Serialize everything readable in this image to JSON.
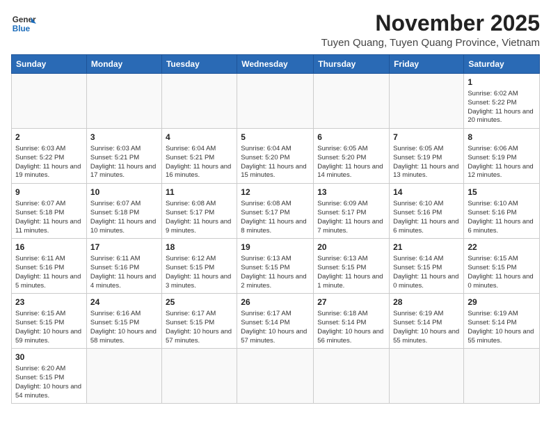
{
  "header": {
    "logo_general": "General",
    "logo_blue": "Blue",
    "month_title": "November 2025",
    "location": "Tuyen Quang, Tuyen Quang Province, Vietnam"
  },
  "days_of_week": [
    "Sunday",
    "Monday",
    "Tuesday",
    "Wednesday",
    "Thursday",
    "Friday",
    "Saturday"
  ],
  "weeks": [
    [
      {
        "day": "",
        "info": ""
      },
      {
        "day": "",
        "info": ""
      },
      {
        "day": "",
        "info": ""
      },
      {
        "day": "",
        "info": ""
      },
      {
        "day": "",
        "info": ""
      },
      {
        "day": "",
        "info": ""
      },
      {
        "day": "1",
        "info": "Sunrise: 6:02 AM\nSunset: 5:22 PM\nDaylight: 11 hours and 20 minutes."
      }
    ],
    [
      {
        "day": "2",
        "info": "Sunrise: 6:03 AM\nSunset: 5:22 PM\nDaylight: 11 hours and 19 minutes."
      },
      {
        "day": "3",
        "info": "Sunrise: 6:03 AM\nSunset: 5:21 PM\nDaylight: 11 hours and 17 minutes."
      },
      {
        "day": "4",
        "info": "Sunrise: 6:04 AM\nSunset: 5:21 PM\nDaylight: 11 hours and 16 minutes."
      },
      {
        "day": "5",
        "info": "Sunrise: 6:04 AM\nSunset: 5:20 PM\nDaylight: 11 hours and 15 minutes."
      },
      {
        "day": "6",
        "info": "Sunrise: 6:05 AM\nSunset: 5:20 PM\nDaylight: 11 hours and 14 minutes."
      },
      {
        "day": "7",
        "info": "Sunrise: 6:05 AM\nSunset: 5:19 PM\nDaylight: 11 hours and 13 minutes."
      },
      {
        "day": "8",
        "info": "Sunrise: 6:06 AM\nSunset: 5:19 PM\nDaylight: 11 hours and 12 minutes."
      }
    ],
    [
      {
        "day": "9",
        "info": "Sunrise: 6:07 AM\nSunset: 5:18 PM\nDaylight: 11 hours and 11 minutes."
      },
      {
        "day": "10",
        "info": "Sunrise: 6:07 AM\nSunset: 5:18 PM\nDaylight: 11 hours and 10 minutes."
      },
      {
        "day": "11",
        "info": "Sunrise: 6:08 AM\nSunset: 5:17 PM\nDaylight: 11 hours and 9 minutes."
      },
      {
        "day": "12",
        "info": "Sunrise: 6:08 AM\nSunset: 5:17 PM\nDaylight: 11 hours and 8 minutes."
      },
      {
        "day": "13",
        "info": "Sunrise: 6:09 AM\nSunset: 5:17 PM\nDaylight: 11 hours and 7 minutes."
      },
      {
        "day": "14",
        "info": "Sunrise: 6:10 AM\nSunset: 5:16 PM\nDaylight: 11 hours and 6 minutes."
      },
      {
        "day": "15",
        "info": "Sunrise: 6:10 AM\nSunset: 5:16 PM\nDaylight: 11 hours and 6 minutes."
      }
    ],
    [
      {
        "day": "16",
        "info": "Sunrise: 6:11 AM\nSunset: 5:16 PM\nDaylight: 11 hours and 5 minutes."
      },
      {
        "day": "17",
        "info": "Sunrise: 6:11 AM\nSunset: 5:16 PM\nDaylight: 11 hours and 4 minutes."
      },
      {
        "day": "18",
        "info": "Sunrise: 6:12 AM\nSunset: 5:15 PM\nDaylight: 11 hours and 3 minutes."
      },
      {
        "day": "19",
        "info": "Sunrise: 6:13 AM\nSunset: 5:15 PM\nDaylight: 11 hours and 2 minutes."
      },
      {
        "day": "20",
        "info": "Sunrise: 6:13 AM\nSunset: 5:15 PM\nDaylight: 11 hours and 1 minute."
      },
      {
        "day": "21",
        "info": "Sunrise: 6:14 AM\nSunset: 5:15 PM\nDaylight: 11 hours and 0 minutes."
      },
      {
        "day": "22",
        "info": "Sunrise: 6:15 AM\nSunset: 5:15 PM\nDaylight: 11 hours and 0 minutes."
      }
    ],
    [
      {
        "day": "23",
        "info": "Sunrise: 6:15 AM\nSunset: 5:15 PM\nDaylight: 10 hours and 59 minutes."
      },
      {
        "day": "24",
        "info": "Sunrise: 6:16 AM\nSunset: 5:15 PM\nDaylight: 10 hours and 58 minutes."
      },
      {
        "day": "25",
        "info": "Sunrise: 6:17 AM\nSunset: 5:15 PM\nDaylight: 10 hours and 57 minutes."
      },
      {
        "day": "26",
        "info": "Sunrise: 6:17 AM\nSunset: 5:14 PM\nDaylight: 10 hours and 57 minutes."
      },
      {
        "day": "27",
        "info": "Sunrise: 6:18 AM\nSunset: 5:14 PM\nDaylight: 10 hours and 56 minutes."
      },
      {
        "day": "28",
        "info": "Sunrise: 6:19 AM\nSunset: 5:14 PM\nDaylight: 10 hours and 55 minutes."
      },
      {
        "day": "29",
        "info": "Sunrise: 6:19 AM\nSunset: 5:14 PM\nDaylight: 10 hours and 55 minutes."
      }
    ],
    [
      {
        "day": "30",
        "info": "Sunrise: 6:20 AM\nSunset: 5:15 PM\nDaylight: 10 hours and 54 minutes."
      },
      {
        "day": "",
        "info": ""
      },
      {
        "day": "",
        "info": ""
      },
      {
        "day": "",
        "info": ""
      },
      {
        "day": "",
        "info": ""
      },
      {
        "day": "",
        "info": ""
      },
      {
        "day": "",
        "info": ""
      }
    ]
  ]
}
